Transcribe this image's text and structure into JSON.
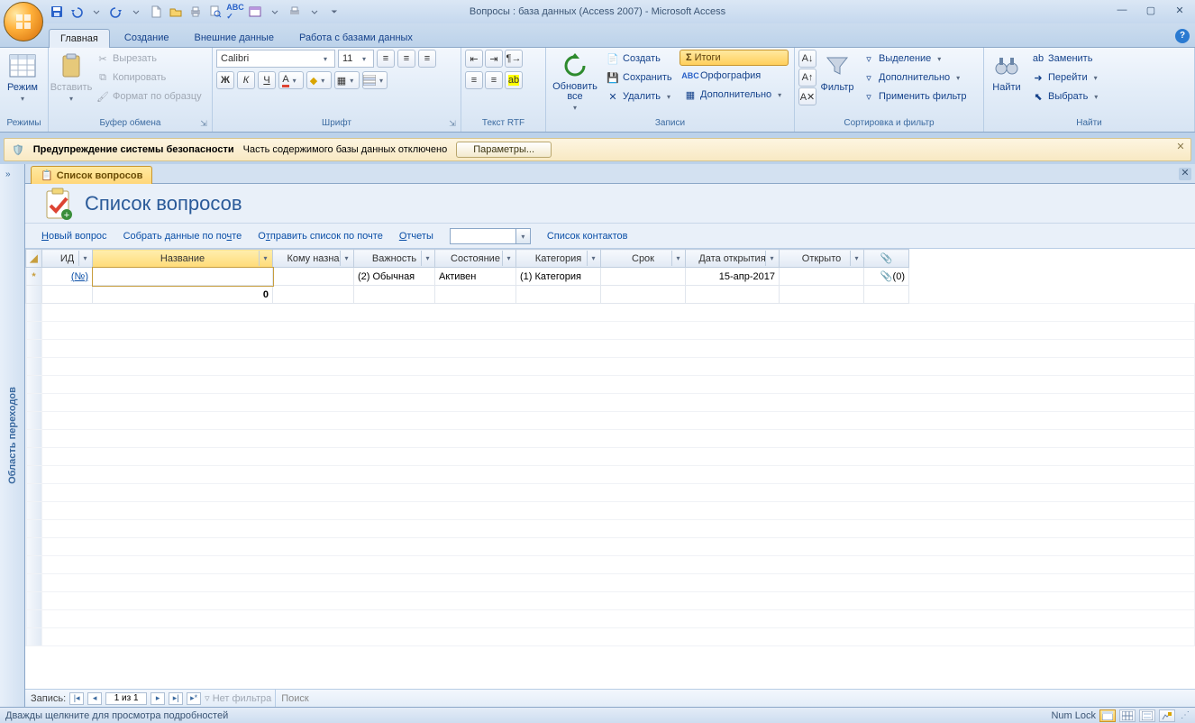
{
  "title": "Вопросы : база данных (Access 2007) - Microsoft Access",
  "qat": {
    "save": "save-icon",
    "undo": "undo-icon",
    "redo": "redo-icon",
    "new": "new-doc-icon",
    "open": "open-icon",
    "print": "print-icon",
    "preview": "print-preview-icon",
    "spell": "spellcheck-icon",
    "form": "form-icon",
    "quickprint": "quick-print-icon"
  },
  "tabs": [
    "Главная",
    "Создание",
    "Внешние данные",
    "Работа с базами данных"
  ],
  "ribbon": {
    "modes": {
      "label": "Режимы",
      "btn": "Режим"
    },
    "clipboard": {
      "label": "Буфер обмена",
      "paste": "Вставить",
      "cut": "Вырезать",
      "copy": "Копировать",
      "fmt": "Формат по образцу"
    },
    "font": {
      "label": "Шрифт",
      "name": "Calibri",
      "size": "11"
    },
    "rtf": {
      "label": "Текст RTF"
    },
    "records": {
      "label": "Записи",
      "refresh": "Обновить все",
      "create": "Создать",
      "save": "Сохранить",
      "delete": "Удалить",
      "totals": "Итоги",
      "spell": "Орфография",
      "more": "Дополнительно"
    },
    "sort": {
      "label": "Сортировка и фильтр",
      "filter": "Фильтр",
      "sel": "Выделение",
      "adv": "Дополнительно",
      "apply": "Применить фильтр"
    },
    "find": {
      "label": "Найти",
      "find": "Найти",
      "replace": "Заменить",
      "goto": "Перейти",
      "select": "Выбрать"
    }
  },
  "security": {
    "title": "Предупреждение системы безопасности",
    "msg": "Часть содержимого базы данных отключено",
    "btn": "Параметры..."
  },
  "nav_pane": "Область переходов",
  "doctab": "Список вопросов",
  "form": {
    "title": "Список вопросов",
    "links": [
      "Новый вопрос",
      "Собрать данные по почте",
      "Отправить список по почте"
    ],
    "reports": "Отчеты",
    "contacts": "Список контактов"
  },
  "grid": {
    "cols": [
      "ИД",
      "Название",
      "Кому назна",
      "Важность",
      "Состояние",
      "Категория",
      "Срок",
      "Дата открытия",
      "Открыто",
      ""
    ],
    "row": {
      "id": "(№)",
      "importance": "(2) Обычная",
      "state": "Активен",
      "category": "(1) Категория",
      "date": "15-апр-2017",
      "attach": "(0)",
      "zero": "0"
    }
  },
  "recnav": {
    "label": "Запись:",
    "pos": "1 из 1",
    "nofilter": "Нет фильтра",
    "search": "Поиск"
  },
  "status": {
    "hint": "Дважды щелкните для просмотра подробностей",
    "numlock": "Num Lock"
  }
}
